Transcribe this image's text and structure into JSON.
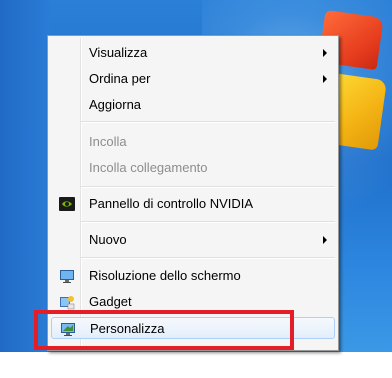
{
  "context_menu": {
    "items": [
      {
        "label": "Visualizza",
        "submenu": true,
        "disabled": false
      },
      {
        "label": "Ordina per",
        "submenu": true,
        "disabled": false
      },
      {
        "label": "Aggiorna",
        "submenu": false,
        "disabled": false
      },
      {
        "label": "Incolla",
        "submenu": false,
        "disabled": true
      },
      {
        "label": "Incolla collegamento",
        "submenu": false,
        "disabled": true
      },
      {
        "label": "Pannello di controllo NVIDIA",
        "submenu": false,
        "disabled": false,
        "icon": "nvidia-icon"
      },
      {
        "label": "Nuovo",
        "submenu": true,
        "disabled": false
      },
      {
        "label": "Risoluzione dello schermo",
        "submenu": false,
        "disabled": false,
        "icon": "monitor-icon"
      },
      {
        "label": "Gadget",
        "submenu": false,
        "disabled": false,
        "icon": "gadget-icon"
      },
      {
        "label": "Personalizza",
        "submenu": false,
        "disabled": false,
        "icon": "personalize-icon",
        "highlighted": true
      }
    ]
  },
  "annotation": {
    "highlighted_item": "Personalizza",
    "frame_color": "#e41e26"
  },
  "colors": {
    "menu_background": "#f5f5f5",
    "disabled_text": "#8d8d8d",
    "hover_border": "#aecff7",
    "desktop_blue": "#2a7fd6"
  }
}
